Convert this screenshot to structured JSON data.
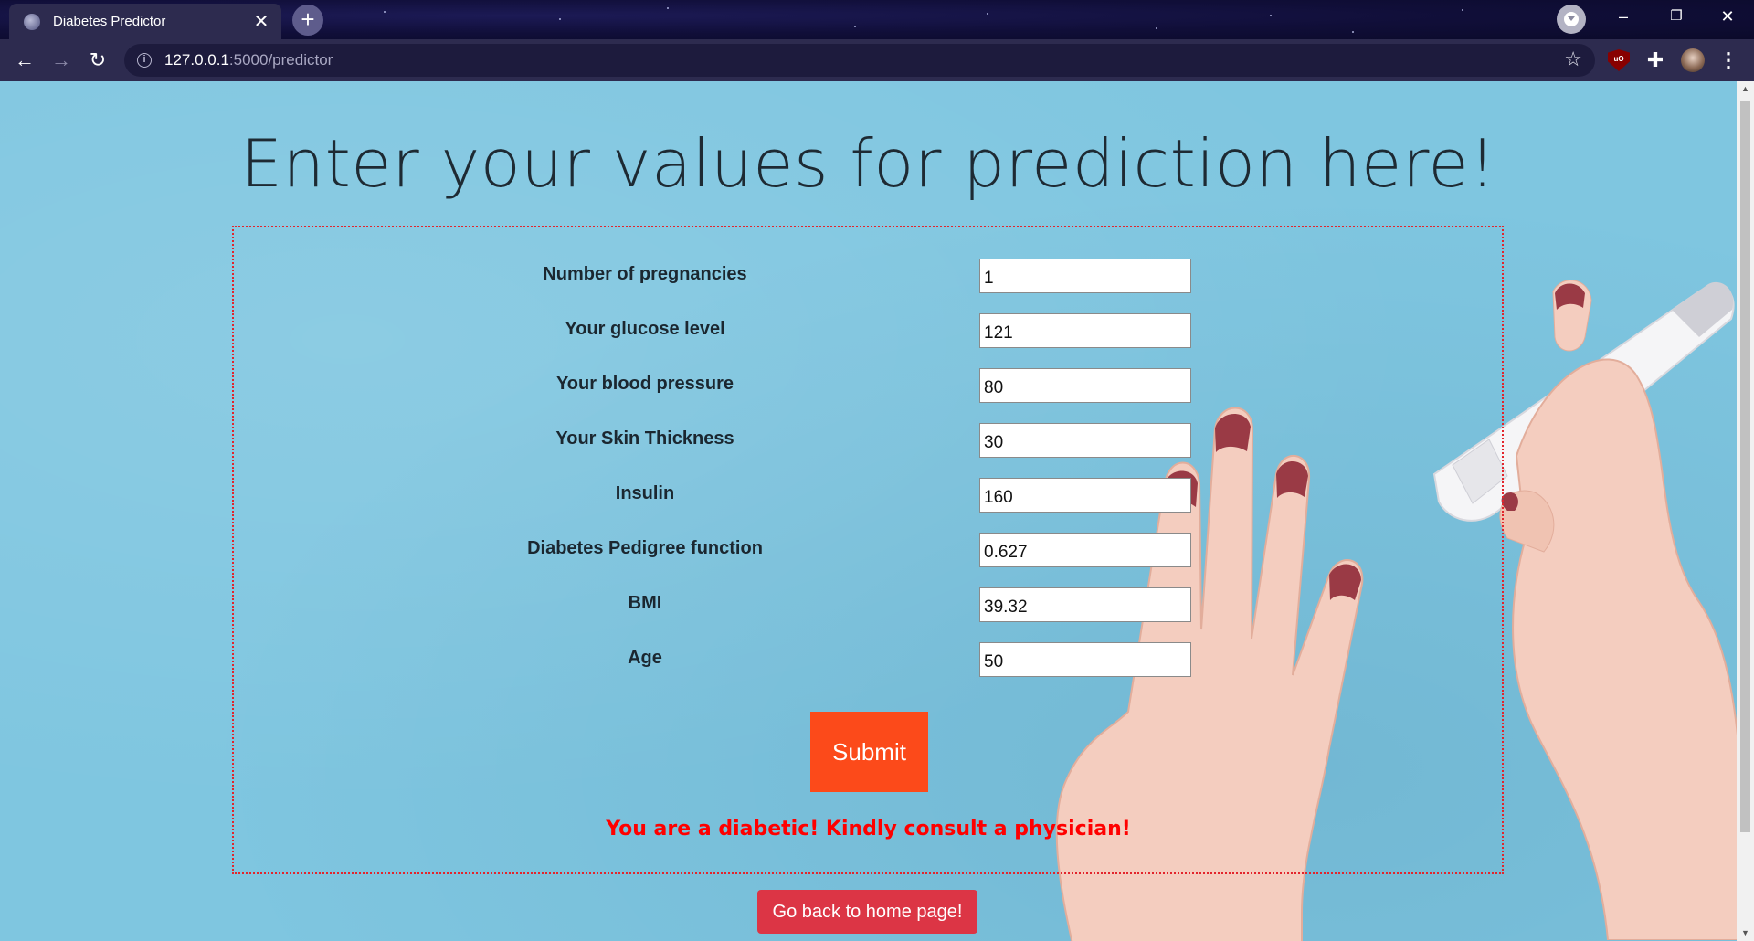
{
  "browser": {
    "tab_title": "Diabetes Predictor",
    "url_host": "127.0.0.1",
    "url_path": ":5000/predictor",
    "icons": {
      "back": "←",
      "forward": "→",
      "reload": "↻",
      "info": "i",
      "star": "☆",
      "close": "✕",
      "new_tab": "+",
      "minimize": "–",
      "restore": "❐",
      "window_close": "✕",
      "puzzle": "✚",
      "menu": "⋮",
      "ublock": "uO"
    }
  },
  "page": {
    "heading": "Enter your values for prediction here!",
    "fields": [
      {
        "label": "Number of pregnancies",
        "value": "1"
      },
      {
        "label": "Your glucose level",
        "value": "121"
      },
      {
        "label": "Your blood pressure",
        "value": "80"
      },
      {
        "label": "Your Skin Thickness",
        "value": "30"
      },
      {
        "label": "Insulin",
        "value": "160"
      },
      {
        "label": "Diabetes Pedigree function",
        "value": "0.627"
      },
      {
        "label": "BMI",
        "value": "39.32"
      },
      {
        "label": "Age",
        "value": "50"
      }
    ],
    "submit_label": "Submit",
    "result": "You are a diabetic! Kindly consult a physician!",
    "home_button": "Go back to home page!",
    "colors": {
      "background": "#7fc6e0",
      "border": "#e3242b",
      "submit": "#fc4a1a",
      "result": "#ff0000",
      "home": "#dc3545"
    }
  }
}
